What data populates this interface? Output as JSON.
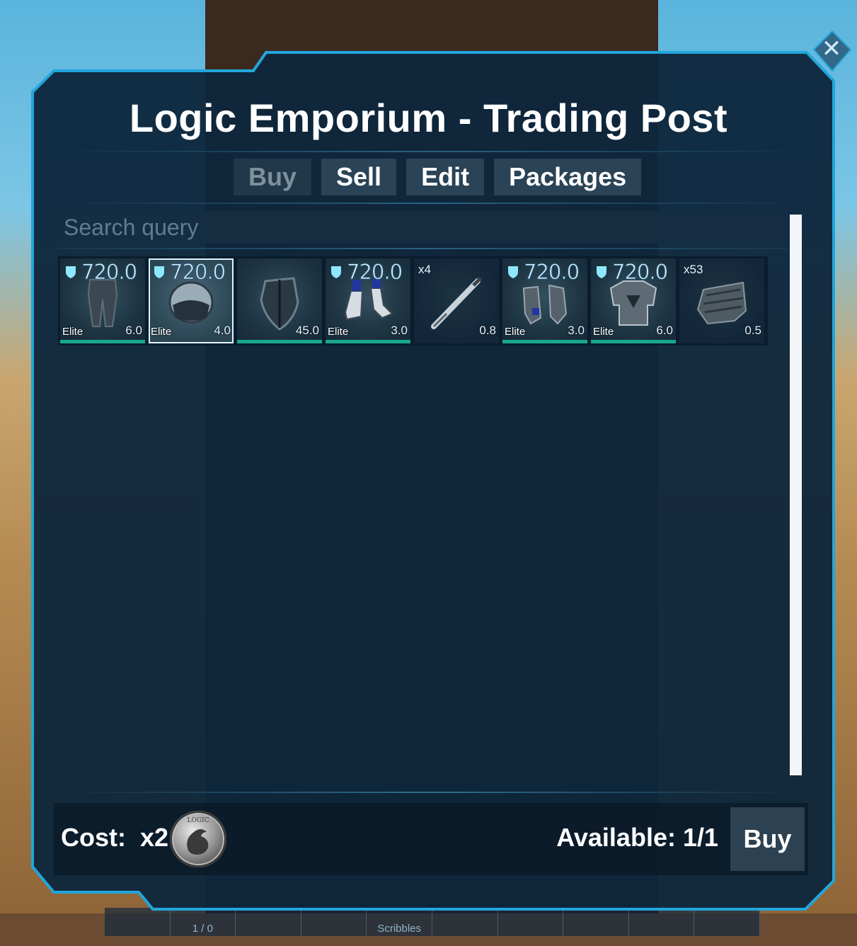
{
  "title": "Logic Emporium - Trading Post",
  "tabs": [
    {
      "label": "Buy",
      "active": false
    },
    {
      "label": "Sell",
      "active": true
    },
    {
      "label": "Edit",
      "active": true
    },
    {
      "label": "Packages",
      "active": true
    }
  ],
  "search": {
    "placeholder": "Search query",
    "value": ""
  },
  "items": [
    {
      "name": "leggings",
      "armor": "720.0",
      "quality": "Elite",
      "weight": "6.0",
      "durability": 1.0,
      "icon": "armor-leggings-icon"
    },
    {
      "name": "helmet",
      "armor": "720.0",
      "quality": "Elite",
      "weight": "4.0",
      "durability": 1.0,
      "icon": "armor-helmet-icon",
      "selected": true
    },
    {
      "name": "shield",
      "armor": "",
      "quality": "",
      "weight": "45.0",
      "durability": 1.0,
      "icon": "shield-icon"
    },
    {
      "name": "boots",
      "armor": "720.0",
      "quality": "Elite",
      "weight": "3.0",
      "durability": 1.0,
      "icon": "armor-boots-icon"
    },
    {
      "name": "syringe",
      "quantity": "x4",
      "weight": "0.8",
      "icon": "syringe-icon"
    },
    {
      "name": "gauntlets",
      "armor": "720.0",
      "quality": "Elite",
      "weight": "3.0",
      "durability": 1.0,
      "icon": "armor-gauntlets-icon"
    },
    {
      "name": "chestpiece",
      "armor": "720.0",
      "quality": "Elite",
      "weight": "6.0",
      "durability": 1.0,
      "icon": "armor-chestpiece-icon"
    },
    {
      "name": "hide",
      "quantity": "x53",
      "weight": "0.5",
      "icon": "hide-resource-icon"
    }
  ],
  "footer": {
    "cost_label": "Cost:  x2",
    "coin_icon": "logic-coin-icon",
    "coin_text": "LOGIC",
    "available": "Available: 1/1",
    "buy_label": "Buy"
  },
  "hotbar": {
    "slot1_label": "1 / 0",
    "slot5_label": "Scribbles"
  },
  "colors": {
    "accent": "#1fa8d8",
    "durability": "#19a88e",
    "panel": "#0e263c"
  }
}
